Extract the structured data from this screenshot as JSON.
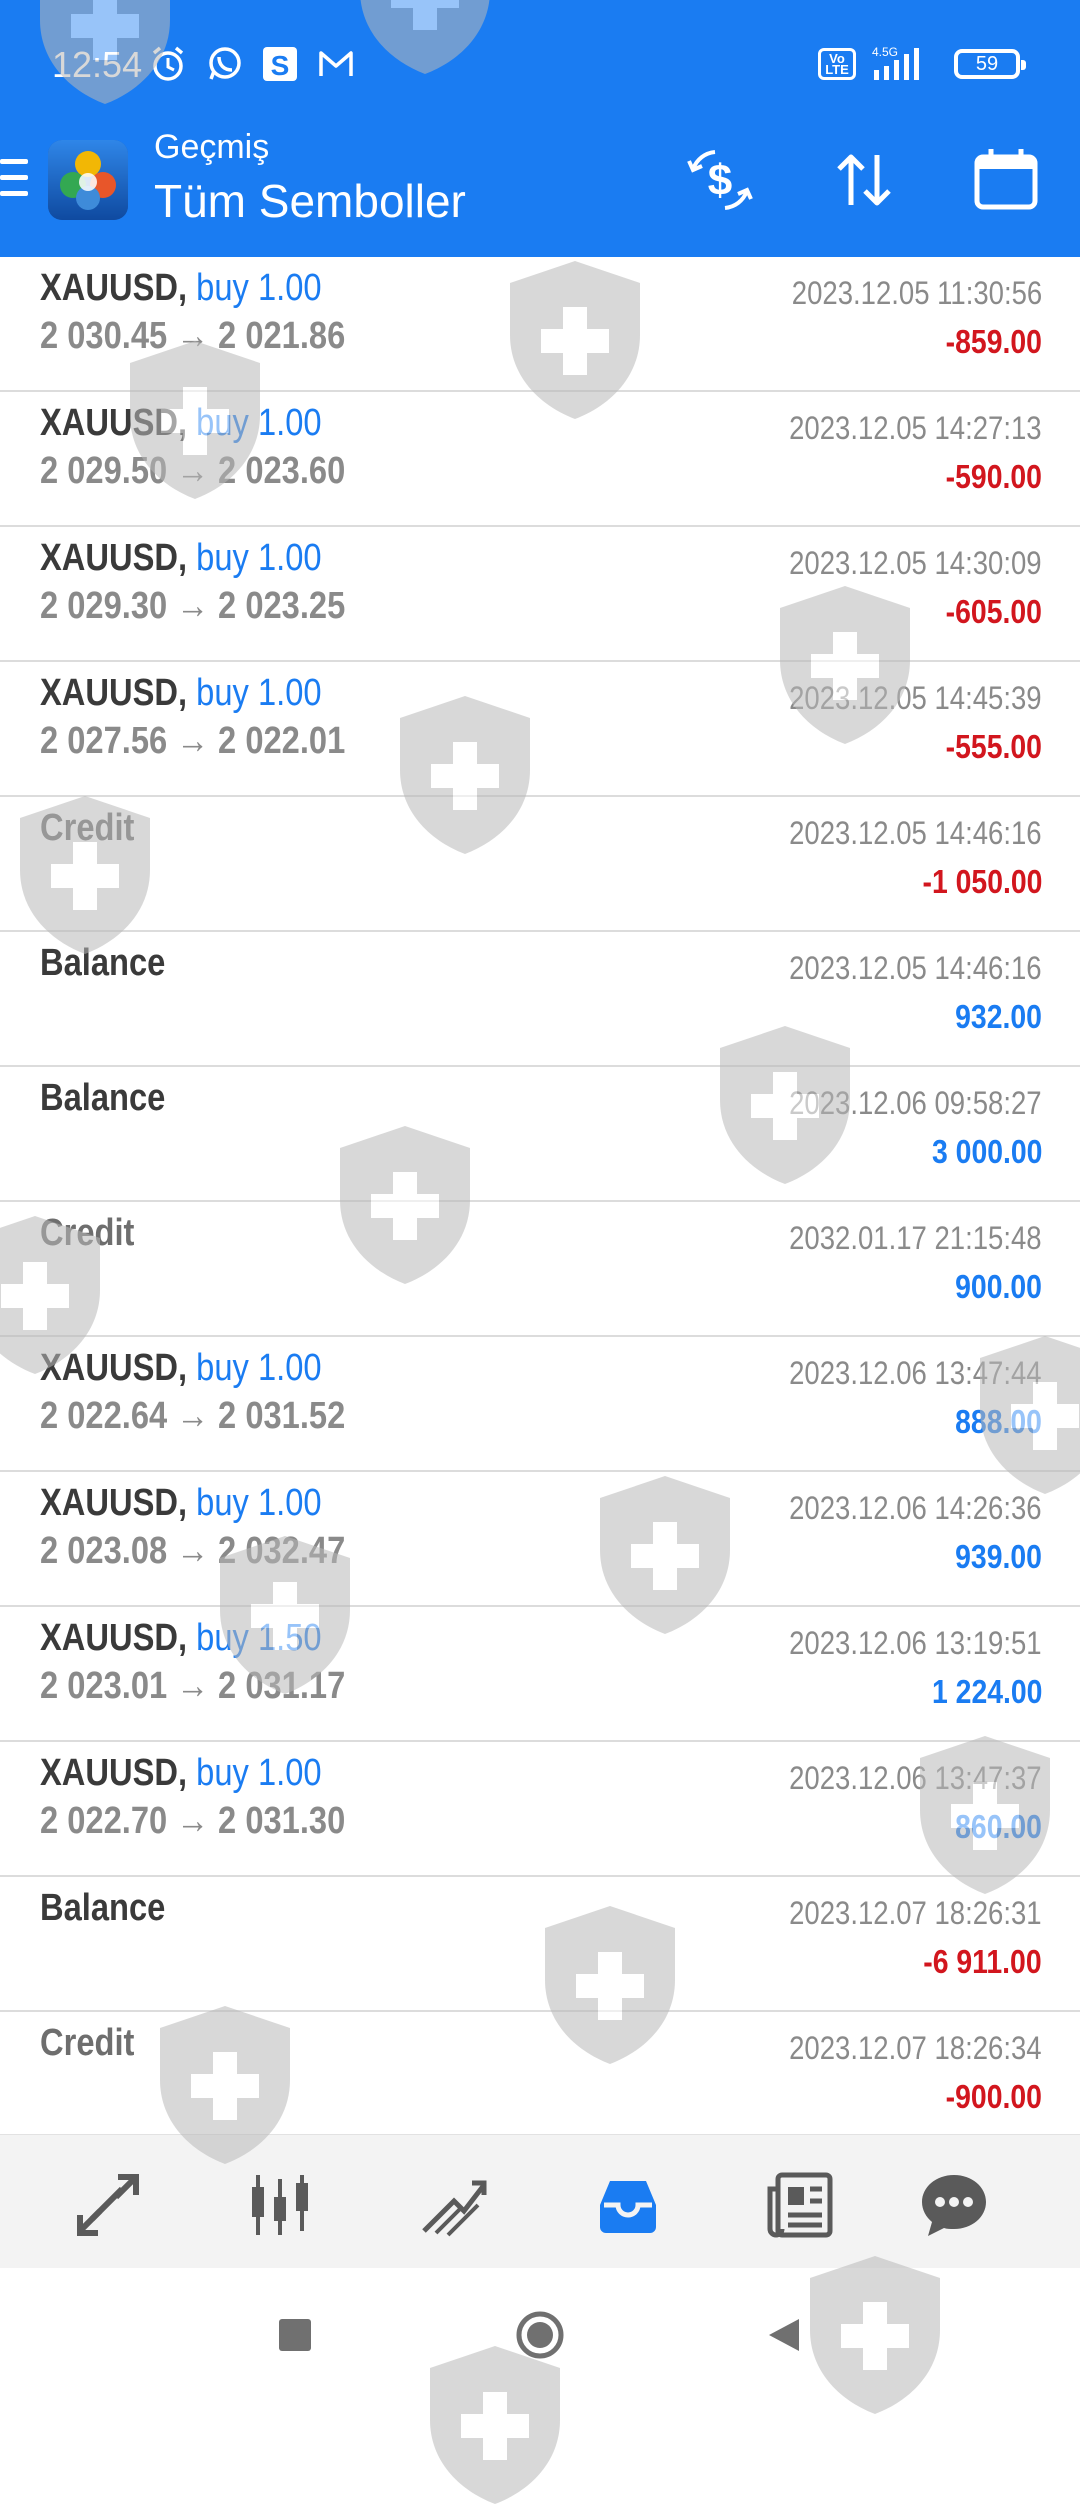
{
  "status_bar": {
    "time": "12:54",
    "network": "4.5G",
    "volte": "Vo LTE",
    "battery": "59"
  },
  "header": {
    "subtitle": "Geçmiş",
    "title": "Tüm Semboller"
  },
  "history": [
    {
      "kind": "trade",
      "symbol": "XAUUSD,",
      "side": "buy 1.00",
      "open": "2 030.45",
      "close": "2 021.86",
      "date": "2023.12.05 11:30:56",
      "profit": "-859.00",
      "sign": "neg"
    },
    {
      "kind": "trade",
      "symbol": "XAUUSD,",
      "side": "buy 1.00",
      "open": "2 029.50",
      "close": "2 023.60",
      "date": "2023.12.05 14:27:13",
      "profit": "-590.00",
      "sign": "neg"
    },
    {
      "kind": "trade",
      "symbol": "XAUUSD,",
      "side": "buy 1.00",
      "open": "2 029.30",
      "close": "2 023.25",
      "date": "2023.12.05 14:30:09",
      "profit": "-605.00",
      "sign": "neg"
    },
    {
      "kind": "trade",
      "symbol": "XAUUSD,",
      "side": "buy 1.00",
      "open": "2 027.56",
      "close": "2 022.01",
      "date": "2023.12.05 14:45:39",
      "profit": "-555.00",
      "sign": "neg"
    },
    {
      "kind": "op",
      "label": "Credit",
      "date": "2023.12.05 14:46:16",
      "profit": "-1 050.00",
      "sign": "neg"
    },
    {
      "kind": "op",
      "label": "Balance",
      "date": "2023.12.05 14:46:16",
      "profit": "932.00",
      "sign": "pos"
    },
    {
      "kind": "op",
      "label": "Balance",
      "date": "2023.12.06 09:58:27",
      "profit": "3 000.00",
      "sign": "pos"
    },
    {
      "kind": "op",
      "label": "Credit",
      "date": "2032.01.17 21:15:48",
      "profit": "900.00",
      "sign": "pos"
    },
    {
      "kind": "trade",
      "symbol": "XAUUSD,",
      "side": "buy 1.00",
      "open": "2 022.64",
      "close": "2 031.52",
      "date": "2023.12.06 13:47:44",
      "profit": "888.00",
      "sign": "pos"
    },
    {
      "kind": "trade",
      "symbol": "XAUUSD,",
      "side": "buy 1.00",
      "open": "2 023.08",
      "close": "2 032.47",
      "date": "2023.12.06 14:26:36",
      "profit": "939.00",
      "sign": "pos"
    },
    {
      "kind": "trade",
      "symbol": "XAUUSD,",
      "side": "buy 1.50",
      "open": "2 023.01",
      "close": "2 031.17",
      "date": "2023.12.06 13:19:51",
      "profit": "1 224.00",
      "sign": "pos"
    },
    {
      "kind": "trade",
      "symbol": "XAUUSD,",
      "side": "buy 1.00",
      "open": "2 022.70",
      "close": "2 031.30",
      "date": "2023.12.06 13:47:37",
      "profit": "860.00",
      "sign": "pos"
    },
    {
      "kind": "op",
      "label": "Balance",
      "date": "2023.12.07 18:26:31",
      "profit": "-6 911.00",
      "sign": "neg"
    },
    {
      "kind": "op",
      "label": "Credit",
      "date": "2023.12.07 18:26:34",
      "profit": "-900.00",
      "sign": "neg"
    }
  ],
  "tabs": [
    {
      "icon": "quotes-icon",
      "active": false
    },
    {
      "icon": "chart-icon",
      "active": false
    },
    {
      "icon": "trade-icon",
      "active": false
    },
    {
      "icon": "history-icon",
      "active": true
    },
    {
      "icon": "news-icon",
      "active": false
    },
    {
      "icon": "chat-icon",
      "active": false
    }
  ],
  "colors": {
    "primary": "#1a7cf2",
    "negative": "#d2161e",
    "positive": "#1a7cf2",
    "text_dark": "#3a3a3a",
    "text_grey": "#8a8a8a"
  }
}
